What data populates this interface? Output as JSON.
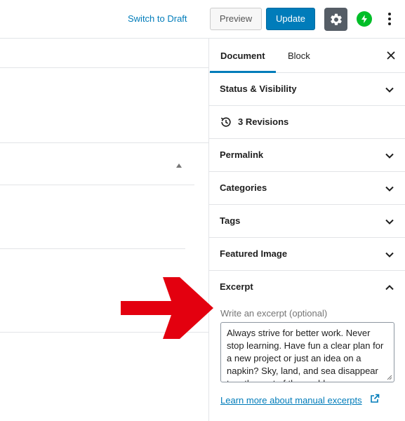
{
  "topbar": {
    "switch_draft": "Switch to Draft",
    "preview": "Preview",
    "update": "Update"
  },
  "sidebar": {
    "tabs": [
      {
        "label": "Document",
        "active": true
      },
      {
        "label": "Block",
        "active": false
      }
    ],
    "panels": [
      {
        "label": "Status & Visibility",
        "expanded": false
      },
      {
        "label": "3 Revisions",
        "icon": "history-icon"
      },
      {
        "label": "Permalink",
        "expanded": false
      },
      {
        "label": "Categories",
        "expanded": false
      },
      {
        "label": "Tags",
        "expanded": false
      },
      {
        "label": "Featured Image",
        "expanded": false
      }
    ],
    "excerpt": {
      "title": "Excerpt",
      "expanded": true,
      "field_label": "Write an excerpt (optional)",
      "value": "Always strive for better work. Never stop learning. Have fun a clear plan for a new project or just an idea on a napkin? Sky, land, and sea disappear together out of the world.",
      "help_link": "Learn more about manual excerpts"
    }
  },
  "colors": {
    "accent": "#007cba",
    "settings_bg": "#555d66",
    "jetpack": "#00be28",
    "annotation_arrow": "#e3000f"
  }
}
